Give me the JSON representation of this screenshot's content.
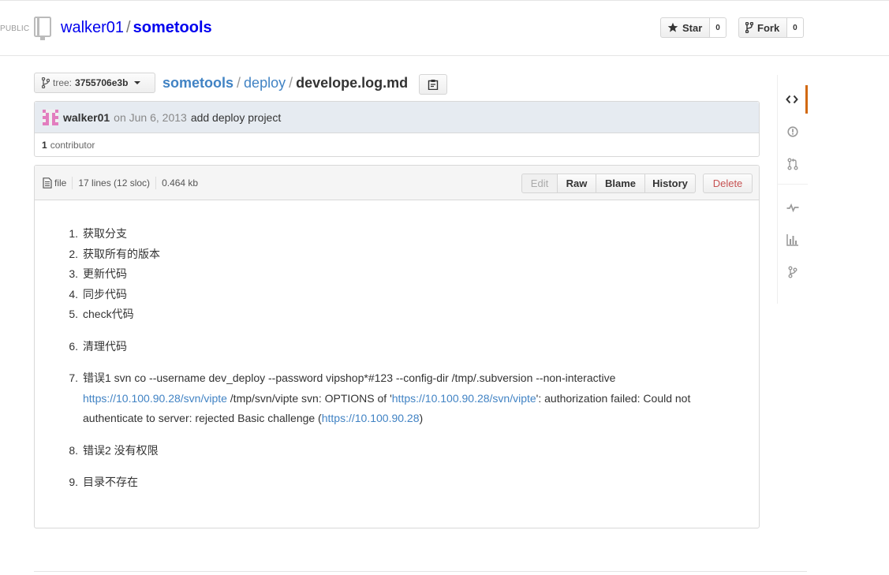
{
  "repo": {
    "visibility": "PUBLIC",
    "owner": "walker01",
    "separator": "/",
    "name": "sometools"
  },
  "actions": {
    "star_label": "Star",
    "star_count": "0",
    "fork_label": "Fork",
    "fork_count": "0"
  },
  "breadcrumb": {
    "tree_label": "tree:",
    "tree_value": "3755706e3b",
    "root": "sometools",
    "folder": "deploy",
    "file": "develope.log.md",
    "separator": "/"
  },
  "commit": {
    "author": "walker01",
    "date": "on Jun 6, 2013",
    "message": "add deploy project",
    "contributor_count": "1",
    "contributor_label": "contributor"
  },
  "file": {
    "type_label": "file",
    "lines": "17 lines (12 sloc)",
    "size": "0.464 kb",
    "buttons": {
      "edit": "Edit",
      "raw": "Raw",
      "blame": "Blame",
      "history": "History",
      "delete": "Delete"
    }
  },
  "content": {
    "items": [
      {
        "num": "1.",
        "text": "获取分支"
      },
      {
        "num": "2.",
        "text": "获取所有的版本"
      },
      {
        "num": "3.",
        "text": "更新代码"
      },
      {
        "num": "4.",
        "text": "同步代码"
      },
      {
        "num": "5.",
        "text": "check代码"
      },
      {
        "num": "6.",
        "text": "清理代码"
      },
      {
        "num": "7.",
        "text_a": "错误1 svn co --username dev_deploy --password vipshop*#123 --config-dir /tmp/.subversion --non-interactive ",
        "link_1": "https://10.100.90.28/svn/vipte",
        "text_b": " /tmp/svn/vipte svn: OPTIONS of '",
        "link_2": "https://10.100.90.28/svn/vipte",
        "text_c": "': authorization failed: Could not authenticate to server: rejected Basic challenge (",
        "link_3": "https://10.100.90.28",
        "text_d": ")"
      },
      {
        "num": "8.",
        "text": "错误2 没有权限"
      },
      {
        "num": "9.",
        "text": "目录不存在"
      }
    ]
  },
  "colors": {
    "link": "#4183c4",
    "nav_selected": "#d26911",
    "commit_bg": "#e6ebf1",
    "danger": "#c65353"
  },
  "nav_icons": [
    "code-icon",
    "issues-icon",
    "pull-request-icon",
    "pulse-icon",
    "graphs-icon",
    "network-icon"
  ]
}
